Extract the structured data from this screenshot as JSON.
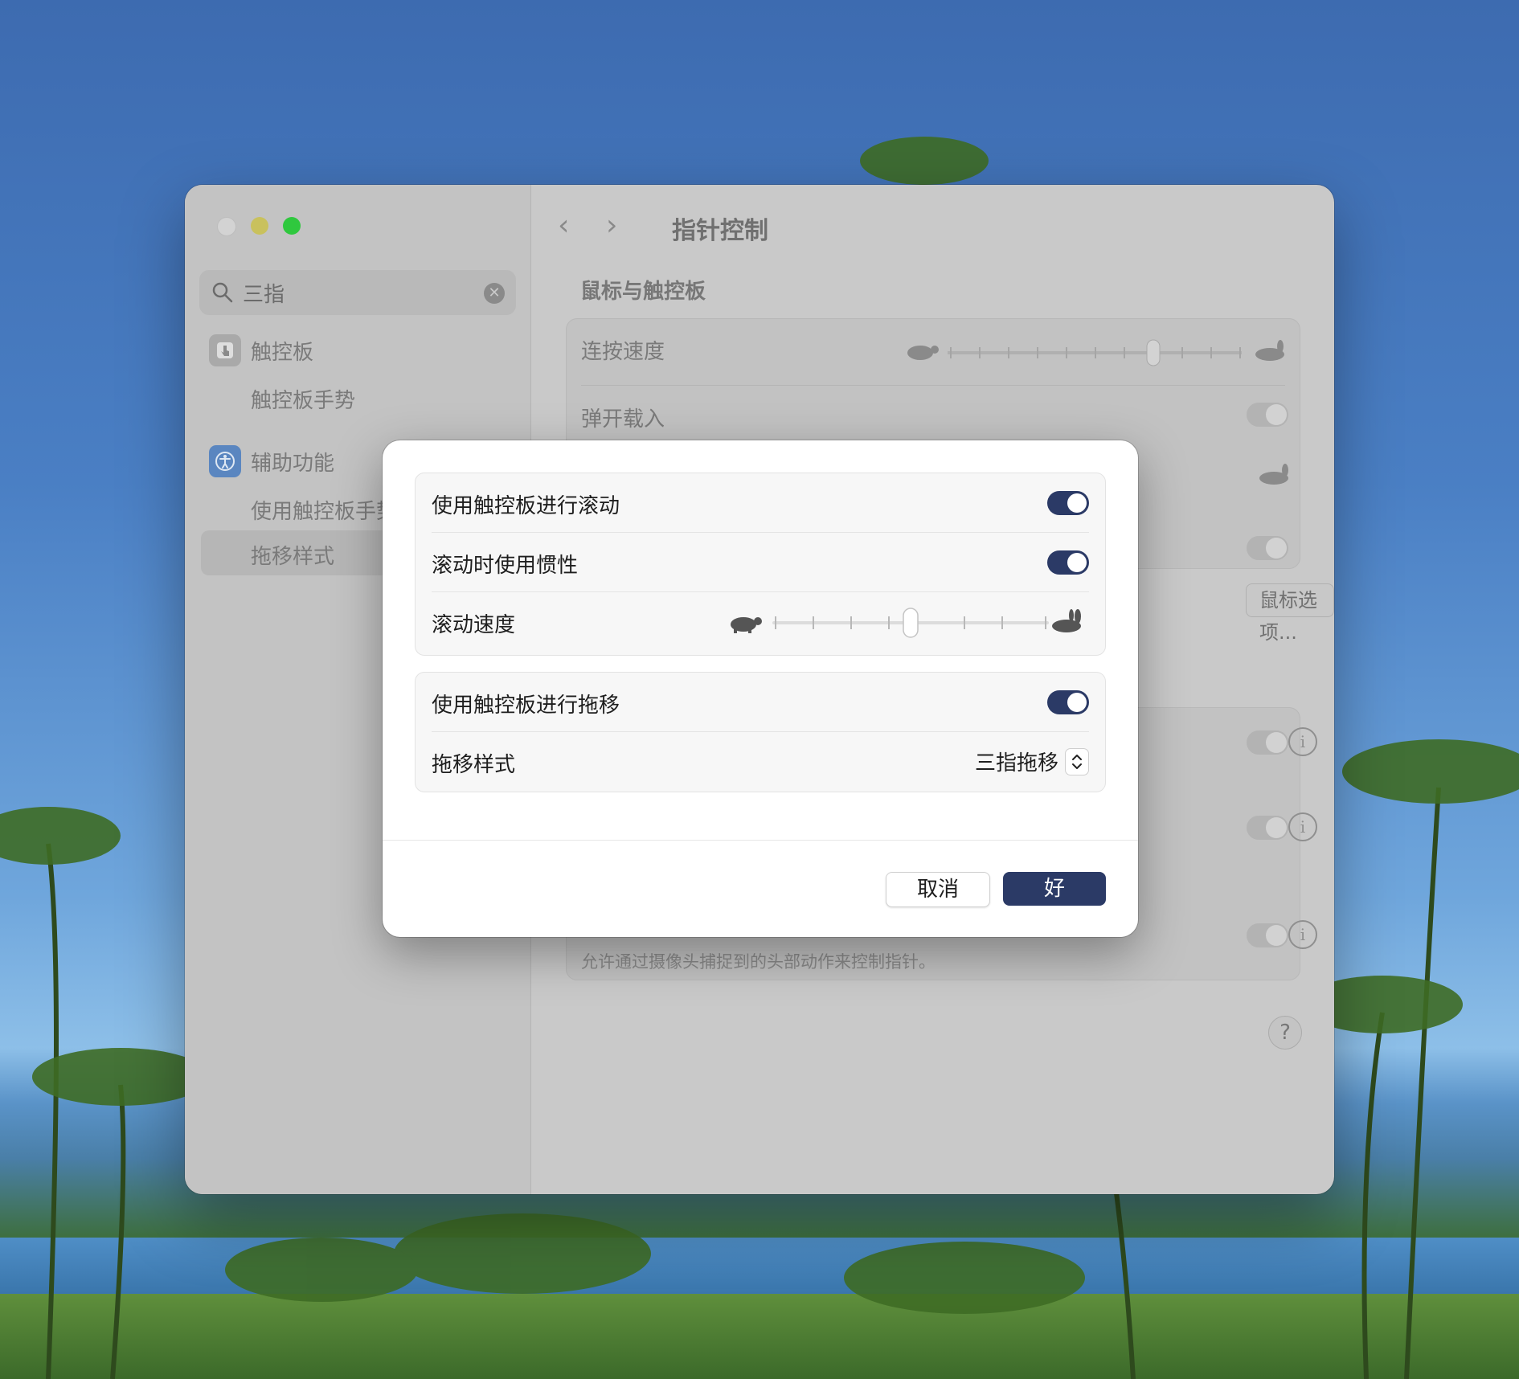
{
  "window": {
    "title": "指针控制",
    "search_query": "三指",
    "sidebar": {
      "items": [
        {
          "label": "触控板",
          "icon": "trackpad-icon"
        },
        {
          "label": "触控板手势"
        },
        {
          "label": "辅助功能",
          "icon": "accessibility-icon"
        },
        {
          "label": "使用触控板手势"
        },
        {
          "label": "拖移样式"
        }
      ]
    },
    "content": {
      "section_title": "鼠标与触控板",
      "rows": [
        {
          "label": "连按速度"
        },
        {
          "label": "弹开载入"
        }
      ],
      "mouse_options_button": "鼠标选项...",
      "truncated_button": "...",
      "head_tracking_description": "允许通过摄像头捕捉到的头部动作来控制指针。",
      "help_label": "?",
      "info_label": "i"
    }
  },
  "dialog": {
    "group1": {
      "scroll_toggle_label": "使用触控板进行滚动",
      "scroll_toggle_on": true,
      "inertia_label": "滚动时使用惯性",
      "inertia_on": true,
      "speed_label": "滚动速度",
      "speed_value": 0.5
    },
    "group2": {
      "drag_toggle_label": "使用触控板进行拖移",
      "drag_toggle_on": true,
      "drag_style_label": "拖移样式",
      "drag_style_value": "三指拖移"
    },
    "cancel_label": "取消",
    "ok_label": "好"
  },
  "colors": {
    "accent": "#2b3a66",
    "traffic_green": "#2fc83e",
    "traffic_yellow": "#c9c15d"
  }
}
